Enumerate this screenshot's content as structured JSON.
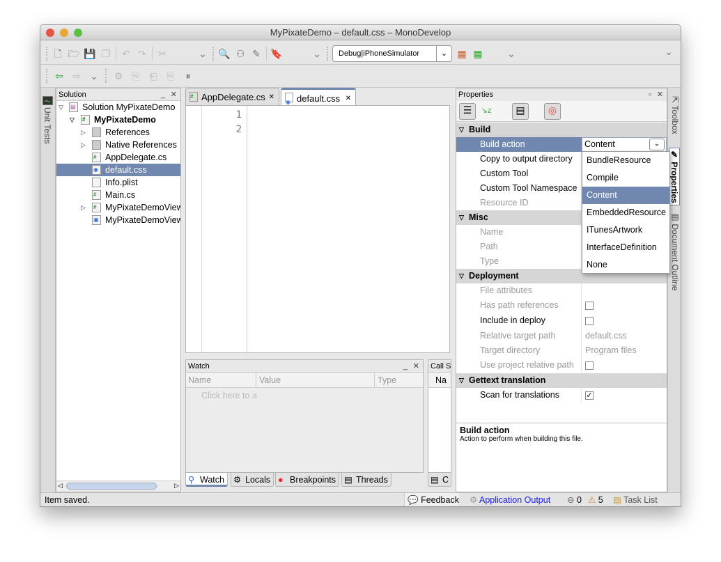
{
  "title": "MyPixateDemo – default.css – MonoDevelop",
  "toolbar": {
    "config": "Debug|iPhoneSimulator"
  },
  "left_strip": {
    "unit_tests": "Unit Tests"
  },
  "solution": {
    "title": "Solution",
    "items": [
      {
        "label": "Solution MyPixateDemo"
      },
      {
        "label": "MyPixateDemo"
      },
      {
        "label": "References"
      },
      {
        "label": "Native References"
      },
      {
        "label": "AppDelegate.cs"
      },
      {
        "label": "default.css"
      },
      {
        "label": "Info.plist"
      },
      {
        "label": "Main.cs"
      },
      {
        "label": "MyPixateDemoView"
      },
      {
        "label": "MyPixateDemoView"
      }
    ]
  },
  "editor": {
    "tabs": [
      {
        "label": "AppDelegate.cs"
      },
      {
        "label": "default.css"
      }
    ],
    "line_numbers": [
      "1",
      "2"
    ]
  },
  "watch": {
    "title": "Watch",
    "columns": [
      "Name",
      "Value",
      "Type"
    ],
    "placeholder": "Click here to a",
    "tabs": [
      {
        "label": "Watch"
      },
      {
        "label": "Locals"
      },
      {
        "label": "Breakpoints"
      },
      {
        "label": "Threads"
      }
    ]
  },
  "callstack": {
    "title": "Call S",
    "column": "Na",
    "tab": "C"
  },
  "properties": {
    "title": "Properties",
    "build": "Build",
    "build_action": "Build action",
    "build_action_value": "Content",
    "copy": "Copy to output directory",
    "custom_tool": "Custom Tool",
    "custom_ns": "Custom Tool Namespace",
    "resource_id": "Resource ID",
    "misc": "Misc",
    "name": "Name",
    "path": "Path",
    "type": "Type",
    "deployment": "Deployment",
    "file_attr": "File attributes",
    "has_path": "Has path references",
    "include": "Include in deploy",
    "rel_path": "Relative target path",
    "rel_path_value": "default.css",
    "target_dir": "Target directory",
    "target_dir_value": "Program files",
    "use_rel": "Use project relative path",
    "gettext": "Gettext translation",
    "scan": "Scan for translations",
    "checks": {
      "has_path": false,
      "include": false,
      "use_rel": false,
      "scan": true
    },
    "desc_title": "Build action",
    "desc_text": "Action to perform when building this file.",
    "options": [
      "BundleResource",
      "Compile",
      "Content",
      "EmbeddedResource",
      "ITunesArtwork",
      "InterfaceDefinition",
      "None"
    ],
    "selected_option": "Content"
  },
  "right_strip": {
    "toolbox": "Toolbox",
    "properties": "Properties",
    "outline": "Document Outline"
  },
  "status": {
    "message": "Item saved.",
    "feedback": "Feedback",
    "app_output": "Application Output",
    "errors": "0",
    "warnings": "5",
    "task_list": "Task List"
  },
  "colors": {
    "selection": "#7088b0",
    "link": "#1a1aff"
  }
}
